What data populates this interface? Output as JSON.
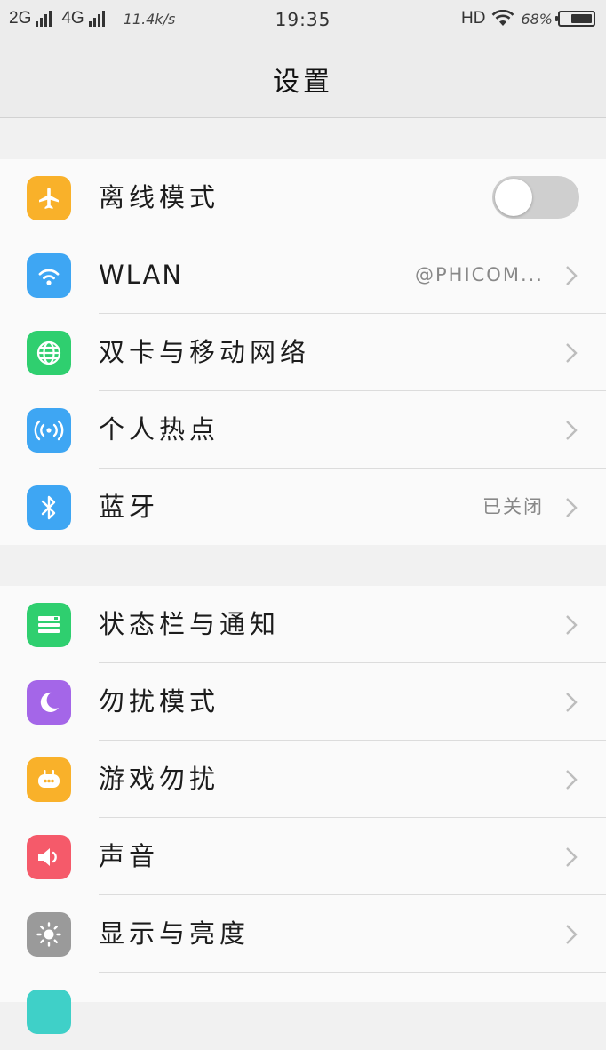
{
  "status_bar": {
    "net1": "2G",
    "net2": "4G",
    "speed": "11.4k/s",
    "time": "19:35",
    "hd": "HD",
    "battery_text": "68%",
    "battery_level": 0.68
  },
  "header": {
    "title": "设置"
  },
  "group1": [
    {
      "label": "离线模式",
      "icon": "airplane-icon",
      "color": "#f9b12a",
      "toggle": false
    },
    {
      "label": "WLAN",
      "icon": "wifi-icon",
      "color": "#3ea6f3",
      "value": "@PHICOM..."
    },
    {
      "label": "双卡与移动网络",
      "icon": "globe-icon",
      "color": "#2fcf6f"
    },
    {
      "label": "个人热点",
      "icon": "hotspot-icon",
      "color": "#3ea6f3"
    },
    {
      "label": "蓝牙",
      "icon": "bluetooth-icon",
      "color": "#3ea6f3",
      "value": "已关闭"
    }
  ],
  "group2": [
    {
      "label": "状态栏与通知",
      "icon": "notification-bar-icon",
      "color": "#2fcf6f"
    },
    {
      "label": "勿扰模式",
      "icon": "moon-icon",
      "color": "#a466e8"
    },
    {
      "label": "游戏勿扰",
      "icon": "gamepad-icon",
      "color": "#f9b12a"
    },
    {
      "label": "声音",
      "icon": "speaker-icon",
      "color": "#f55a6a"
    },
    {
      "label": "显示与亮度",
      "icon": "brightness-icon",
      "color": "#9a9a9a"
    },
    {
      "label": "",
      "icon": "partial-icon",
      "color": "#3fd0c8"
    }
  ]
}
